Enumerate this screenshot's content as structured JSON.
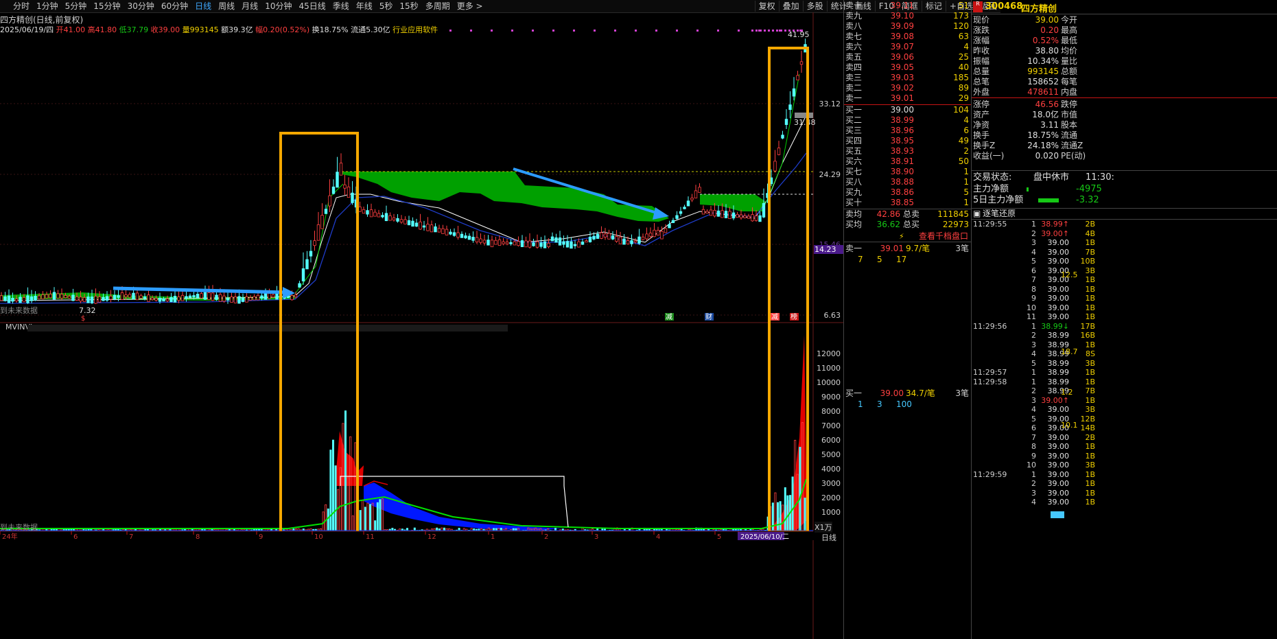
{
  "toolbar": {
    "tabs": [
      "分时",
      "1分钟",
      "5分钟",
      "15分钟",
      "30分钟",
      "60分钟",
      "日线",
      "周线",
      "月线",
      "10分钟",
      "45日线",
      "季线",
      "年线",
      "5秒",
      "15秒",
      "多周期",
      "更多 >"
    ],
    "active_tab": "日线",
    "tools": [
      "复权",
      "叠加",
      "多股",
      "统计",
      "画线",
      "F10",
      "简框",
      "标记",
      "+自选",
      "返回"
    ]
  },
  "chart_header": {
    "title": "四方精创(日线,前复权)",
    "date": "2025/06/19/四",
    "open": "开41.00",
    "high": "高41.80",
    "low": "低37.79",
    "close": "收39.00",
    "volume": "量993145",
    "amount": "额39.3亿",
    "change": "幅0.20(0.52%)",
    "turnover": "换18.75%",
    "float_cap": "流通5.30亿",
    "industry": "行业应用软件"
  },
  "price_axis": {
    "labels": [
      "33.12",
      "24.29",
      "15.46",
      "6.63"
    ],
    "current": "14.23",
    "peak_label": "41.95",
    "low_label": "7.32",
    "mark_label": "31.48"
  },
  "markers": [
    "减",
    "财",
    "减",
    "榜"
  ],
  "indicator": {
    "name": "MVINVI",
    "axis": [
      "12000",
      "11000",
      "10000",
      "9000",
      "8000",
      "7000",
      "6000",
      "5000",
      "4000",
      "3000",
      "2000",
      "1000"
    ],
    "unit": "X1万"
  },
  "x_axis": {
    "labels": [
      "24年",
      "6",
      "7",
      "8",
      "9",
      "10",
      "11",
      "12",
      "1",
      "2",
      "3",
      "4",
      "5",
      "2025/06/10/二"
    ],
    "period": "日线"
  },
  "future_text": "到未来数据",
  "orderbook": {
    "sell": [
      {
        "name": "卖十",
        "price": "39.11",
        "vol": "51"
      },
      {
        "name": "卖九",
        "price": "39.10",
        "vol": "173"
      },
      {
        "name": "卖八",
        "price": "39.09",
        "vol": "120"
      },
      {
        "name": "卖七",
        "price": "39.08",
        "vol": "63"
      },
      {
        "name": "卖六",
        "price": "39.07",
        "vol": "4"
      },
      {
        "name": "卖五",
        "price": "39.06",
        "vol": "25"
      },
      {
        "name": "卖四",
        "price": "39.05",
        "vol": "40"
      },
      {
        "name": "卖三",
        "price": "39.03",
        "vol": "185"
      },
      {
        "name": "卖二",
        "price": "39.02",
        "vol": "89"
      },
      {
        "name": "卖一",
        "price": "39.01",
        "vol": "29"
      }
    ],
    "buy": [
      {
        "name": "买一",
        "price": "39.00",
        "vol": "104"
      },
      {
        "name": "买二",
        "price": "38.99",
        "vol": "4"
      },
      {
        "name": "买三",
        "price": "38.96",
        "vol": "6"
      },
      {
        "name": "买四",
        "price": "38.95",
        "vol": "49"
      },
      {
        "name": "买五",
        "price": "38.93",
        "vol": "2"
      },
      {
        "name": "买六",
        "price": "38.91",
        "vol": "50"
      },
      {
        "name": "买七",
        "price": "38.90",
        "vol": "1"
      },
      {
        "name": "买八",
        "price": "38.88",
        "vol": "1"
      },
      {
        "name": "买九",
        "price": "38.86",
        "vol": "5"
      },
      {
        "name": "买十",
        "price": "38.85",
        "vol": "1"
      }
    ],
    "avg_sell": {
      "label": "卖均",
      "price": "42.86",
      "tl": "总卖",
      "tv": "111845"
    },
    "avg_buy": {
      "label": "买均",
      "price": "36.62",
      "tl": "总买",
      "tv": "22973"
    },
    "view_btn": "查看千档盘口",
    "sell1": {
      "label": "卖一",
      "price": "39.01",
      "avg": "9.7/笔",
      "cnt": "3笔",
      "queue": [
        "7",
        "5",
        "17"
      ]
    },
    "buy1": {
      "label": "买一",
      "price": "39.00",
      "avg": "34.7/笔",
      "cnt": "3笔",
      "queue": [
        "1",
        "3",
        "100"
      ]
    }
  },
  "stock": {
    "code": "300468",
    "name": "四方精创",
    "tag": "R"
  },
  "quote": [
    {
      "l": "现价",
      "v": "39.00",
      "l2": "今开",
      "c": "yel"
    },
    {
      "l": "涨跌",
      "v": "0.20",
      "l2": "最高",
      "c": "up"
    },
    {
      "l": "涨幅",
      "v": "0.52%",
      "l2": "最低",
      "c": "up"
    },
    {
      "l": "昨收",
      "v": "38.80",
      "l2": "均价",
      "c": "wht"
    },
    {
      "l": "振幅",
      "v": "10.34%",
      "l2": "量比",
      "c": "wht"
    },
    {
      "l": "总量",
      "v": "993145",
      "l2": "总额",
      "c": "yel"
    },
    {
      "l": "总笔",
      "v": "158652",
      "l2": "每笔",
      "c": "wht"
    },
    {
      "l": "外盘",
      "v": "478611",
      "l2": "内盘",
      "c": "up"
    },
    {
      "l": "涨停",
      "v": "46.56",
      "l2": "跌停",
      "c": "up"
    },
    {
      "l": "资产",
      "v": "18.0亿",
      "l2": "市值",
      "c": "wht"
    },
    {
      "l": "净资",
      "v": "3.11",
      "l2": "股本",
      "c": "wht"
    },
    {
      "l": "换手",
      "v": "18.75%",
      "l2": "流通",
      "c": "wht"
    },
    {
      "l": "换手Z",
      "v": "24.18%",
      "l2": "流通Z",
      "c": "wht"
    },
    {
      "l": "收益(一)",
      "v": "0.020",
      "l2": "PE(动)",
      "c": "wht"
    }
  ],
  "status": {
    "label": "交易状态:",
    "value": "盘中休市",
    "time": "11:30:"
  },
  "fund_flow": [
    {
      "label": "主力净额",
      "value": "-4975"
    },
    {
      "label": "5日主力净额",
      "value": "-3.32"
    }
  ],
  "ticks_title": "逐笔还原",
  "ticks": [
    {
      "t": "11:29:55",
      "n": "1",
      "p": "38.99",
      "d": "up",
      "v": "2B"
    },
    {
      "t": "",
      "n": "2",
      "p": "39.00",
      "d": "up",
      "v": "4B"
    },
    {
      "t": "",
      "n": "3",
      "p": "39.00",
      "d": "",
      "v": "1B"
    },
    {
      "t": "",
      "n": "4",
      "p": "39.00",
      "d": "",
      "v": "7B"
    },
    {
      "t": "",
      "n": "5",
      "p": "39.00",
      "d": "",
      "v": "10B"
    },
    {
      "t": "",
      "n": "6",
      "p": "39.00",
      "d": "",
      "v": "3B"
    },
    {
      "t": "",
      "n": "7",
      "p": "39.00",
      "d": "",
      "v": "1B"
    },
    {
      "t": "",
      "n": "8",
      "p": "39.00",
      "d": "",
      "v": "1B"
    },
    {
      "t": "",
      "n": "9",
      "p": "39.00",
      "d": "",
      "v": "1B"
    },
    {
      "t": "",
      "n": "10",
      "p": "39.00",
      "d": "",
      "v": "1B"
    },
    {
      "t": "",
      "n": "11",
      "p": "39.00",
      "d": "",
      "v": "1B"
    },
    {
      "t": "11:29:56",
      "n": "1",
      "p": "38.99",
      "d": "dn",
      "v": "17B"
    },
    {
      "t": "",
      "n": "2",
      "p": "38.99",
      "d": "",
      "v": "16B"
    },
    {
      "t": "",
      "n": "3",
      "p": "38.99",
      "d": "",
      "v": "1B"
    },
    {
      "t": "",
      "n": "4",
      "p": "38.99",
      "d": "",
      "v": "8S"
    },
    {
      "t": "",
      "n": "5",
      "p": "38.99",
      "d": "",
      "v": "3B"
    },
    {
      "t": "11:29:57",
      "n": "1",
      "p": "38.99",
      "d": "",
      "v": "1B"
    },
    {
      "t": "11:29:58",
      "n": "1",
      "p": "38.99",
      "d": "",
      "v": "1B"
    },
    {
      "t": "",
      "n": "2",
      "p": "38.99",
      "d": "",
      "v": "7B"
    },
    {
      "t": "",
      "n": "3",
      "p": "39.00",
      "d": "up",
      "v": "1B"
    },
    {
      "t": "",
      "n": "4",
      "p": "39.00",
      "d": "",
      "v": "3B"
    },
    {
      "t": "",
      "n": "5",
      "p": "39.00",
      "d": "",
      "v": "12B"
    },
    {
      "t": "",
      "n": "6",
      "p": "39.00",
      "d": "",
      "v": "14B"
    },
    {
      "t": "",
      "n": "7",
      "p": "39.00",
      "d": "",
      "v": "2B"
    },
    {
      "t": "",
      "n": "8",
      "p": "39.00",
      "d": "",
      "v": "1B"
    },
    {
      "t": "",
      "n": "9",
      "p": "39.00",
      "d": "",
      "v": "1B"
    },
    {
      "t": "",
      "n": "10",
      "p": "39.00",
      "d": "",
      "v": "3B"
    },
    {
      "t": "11:29:59",
      "n": "1",
      "p": "39.00",
      "d": "",
      "v": "1B"
    },
    {
      "t": "",
      "n": "2",
      "p": "39.00",
      "d": "",
      "v": "1B"
    },
    {
      "t": "",
      "n": "3",
      "p": "39.00",
      "d": "",
      "v": "1B"
    },
    {
      "t": "",
      "n": "4",
      "p": "39.00",
      "d": "",
      "v": "1B"
    }
  ],
  "tick_side_labels": [
    "12.5",
    "18.7",
    "1.2",
    "10.1"
  ]
}
